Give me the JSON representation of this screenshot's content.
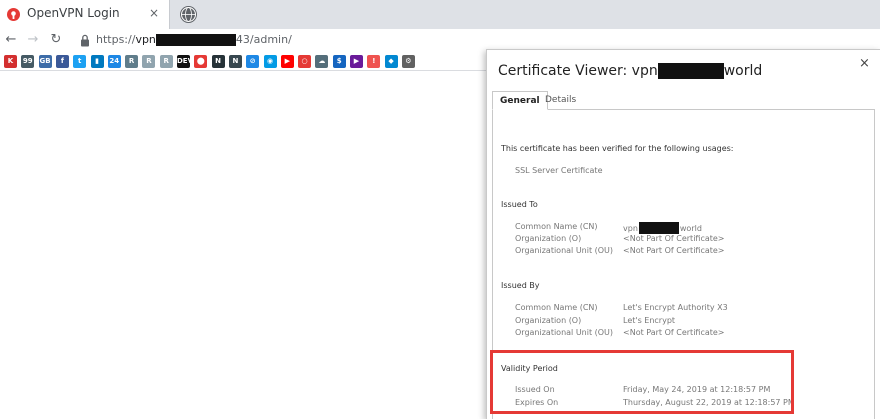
{
  "browser": {
    "tab": {
      "title": "OpenVPN Login",
      "close_glyph": "×",
      "favicon": "openvpn-icon"
    },
    "url": {
      "scheme": "https://",
      "host_prefix": "vpn",
      "path": "43/admin/"
    },
    "nav": {
      "back": "←",
      "forward": "→",
      "reload": "↻"
    },
    "bookmarks": [
      {
        "name": "k",
        "text": "K",
        "color": "#d32f2f"
      },
      {
        "name": "gallery",
        "text": "99",
        "color": "#455a64"
      },
      {
        "name": "translate",
        "text": "GB",
        "color": "#3d6ca8"
      },
      {
        "name": "facebook",
        "text": "f",
        "color": "#3b5998"
      },
      {
        "name": "twitter",
        "text": "t",
        "color": "#1da1f2"
      },
      {
        "name": "trello",
        "text": "▮",
        "color": "#0079bf"
      },
      {
        "name": "24",
        "text": "24",
        "color": "#1e88e5"
      },
      {
        "name": "r1",
        "text": "R",
        "color": "#607d8b"
      },
      {
        "name": "r2",
        "text": "R",
        "color": "#90a4ae"
      },
      {
        "name": "r3",
        "text": "R",
        "color": "#90a4ae"
      },
      {
        "name": "dev",
        "text": "DEV",
        "color": "#111111"
      },
      {
        "name": "openvpn",
        "text": "⬤",
        "color": "#e53935"
      },
      {
        "name": "n1",
        "text": "N",
        "color": "#263238"
      },
      {
        "name": "n2",
        "text": "N",
        "color": "#37474f"
      },
      {
        "name": "blue-circle",
        "text": "⊘",
        "color": "#1e88e5"
      },
      {
        "name": "blue-circle-2",
        "text": "◉",
        "color": "#039be5"
      },
      {
        "name": "youtube",
        "text": "▶",
        "color": "#ff0000"
      },
      {
        "name": "red-ring",
        "text": "○",
        "color": "#e53935"
      },
      {
        "name": "cloud",
        "text": "☁",
        "color": "#546e7a"
      },
      {
        "name": "dollar",
        "text": "$",
        "color": "#1565c0"
      },
      {
        "name": "play",
        "text": "▶",
        "color": "#6a1b9a"
      },
      {
        "name": "thermo",
        "text": "!",
        "color": "#ef5350"
      },
      {
        "name": "drop",
        "text": "◆",
        "color": "#0288d1"
      },
      {
        "name": "gear",
        "text": "⚙",
        "color": "#616161"
      }
    ]
  },
  "dialog": {
    "title_prefix": "Certificate Viewer: vpn",
    "title_suffix": "world",
    "close_glyph": "×",
    "tabs": [
      {
        "label": "General"
      },
      {
        "label": "Details"
      }
    ],
    "verified_text": "This certificate has been verified for the following usages:",
    "usage": "SSL Server Certificate",
    "issued_to": {
      "heading": "Issued To",
      "cn_label": "Common Name (CN)",
      "cn_prefix": "vpn",
      "cn_suffix": "world",
      "org_label": "Organization (O)",
      "org_value": "<Not Part Of Certificate>",
      "ou_label": "Organizational Unit (OU)",
      "ou_value": "<Not Part Of Certificate>"
    },
    "issued_by": {
      "heading": "Issued By",
      "cn_label": "Common Name (CN)",
      "cn_value": "Let's Encrypt Authority X3",
      "org_label": "Organization (O)",
      "org_value": "Let's Encrypt",
      "ou_label": "Organizational Unit (OU)",
      "ou_value": "<Not Part Of Certificate>"
    },
    "validity": {
      "heading": "Validity Period",
      "issued_label": "Issued On",
      "issued_value": "Friday, May 24, 2019 at 12:18:57 PM",
      "expires_label": "Expires On",
      "expires_value": "Thursday, August 22, 2019 at 12:18:57 PM"
    }
  },
  "colors": {
    "highlight": "#e53935",
    "tabstrip": "#dee1e6"
  }
}
